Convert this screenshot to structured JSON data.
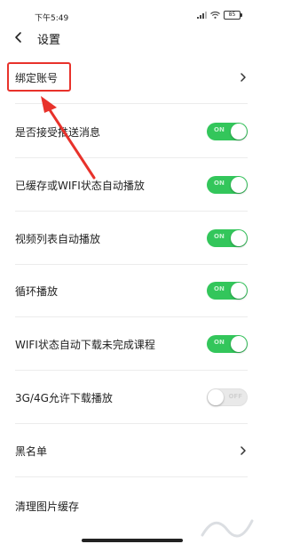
{
  "status_bar": {
    "time": "下午5:49",
    "battery": "85"
  },
  "header": {
    "title": "设置"
  },
  "settings": [
    {
      "label": "绑定账号",
      "control": "chevron"
    },
    {
      "label": "是否接受推送消息",
      "control": "toggle",
      "state": "ON"
    },
    {
      "label": "已缓存或WIFI状态自动播放",
      "control": "toggle",
      "state": "ON"
    },
    {
      "label": "视频列表自动播放",
      "control": "toggle",
      "state": "ON"
    },
    {
      "label": "循环播放",
      "control": "toggle",
      "state": "ON"
    },
    {
      "label": "WIFI状态自动下载未完成课程",
      "control": "toggle",
      "state": "ON"
    },
    {
      "label": "3G/4G允许下载播放",
      "control": "toggle",
      "state": "OFF"
    },
    {
      "label": "黑名单",
      "control": "chevron"
    },
    {
      "label": "清理图片缓存",
      "control": "none"
    }
  ],
  "annotation": {
    "color": "#e8322b"
  },
  "accent_color": "#33c65b"
}
